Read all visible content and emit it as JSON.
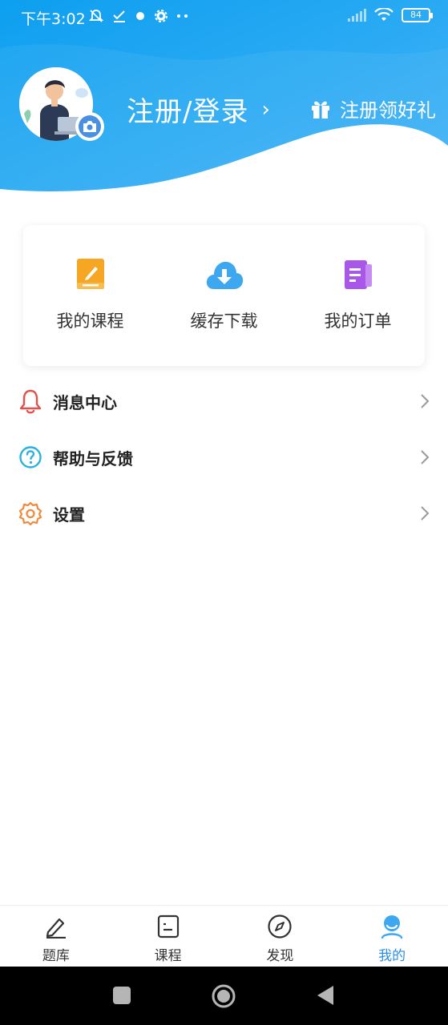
{
  "status_bar": {
    "time": "下午3:02",
    "battery": "84"
  },
  "profile": {
    "login_title": "注册/登录",
    "chevron": "›",
    "gift_label": "注册领好礼",
    "icons": {
      "avatar": "user-avatar-illustration",
      "camera": "camera-icon",
      "gift": "gift-icon"
    }
  },
  "quick_actions": [
    {
      "label": "我的课程",
      "icon": "course-book-icon",
      "color": "#f7a21b"
    },
    {
      "label": "缓存下载",
      "icon": "cloud-download-icon",
      "color": "#3da8f0"
    },
    {
      "label": "我的订单",
      "icon": "order-document-icon",
      "color": "#a957e8"
    }
  ],
  "menu": [
    {
      "label": "消息中心",
      "icon": "bell-icon",
      "color": "#e4514a"
    },
    {
      "label": "帮助与反馈",
      "icon": "help-question-icon",
      "color": "#2bb0e0"
    },
    {
      "label": "设置",
      "icon": "settings-gear-icon",
      "color": "#f08a3c"
    }
  ],
  "tabs": [
    {
      "label": "题库",
      "icon": "edit-pen-icon",
      "active": false
    },
    {
      "label": "课程",
      "icon": "course-list-icon",
      "active": false
    },
    {
      "label": "发现",
      "icon": "compass-icon",
      "active": false
    },
    {
      "label": "我的",
      "icon": "profile-icon",
      "active": true
    }
  ],
  "colors": {
    "header_gradient_start": "#18a0f0",
    "header_gradient_end": "#3fb0f5",
    "accent": "#2a8fe6"
  }
}
